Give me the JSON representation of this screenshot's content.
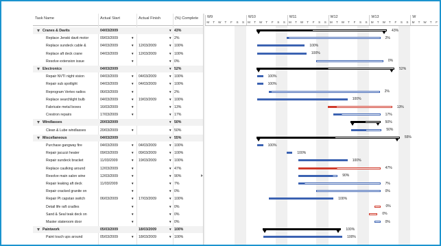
{
  "columns": {
    "name": "Task Name",
    "start": "Actual Start",
    "finish": "Actual Finish",
    "pct": "(%) Complete"
  },
  "dropdown_glyph": "▼",
  "colors": {
    "blue": "#3b62b2",
    "red": "#d03a2b",
    "summary": "#000000",
    "frame": "#1b93ce"
  },
  "weeks": [
    "W9",
    "W10",
    "W11",
    "W12",
    "W13",
    "W"
  ],
  "days": [
    "M",
    "T",
    "W",
    "T",
    "F",
    "S",
    "S"
  ],
  "rows": [
    {
      "level": 0,
      "name": "Cranes & Davits",
      "start": "04/03/2009",
      "finish": "",
      "pct": "43%",
      "bar": {
        "s": 8.8,
        "e": 31.0,
        "p": 0.43
      }
    },
    {
      "level": 1,
      "name": "Replace Jenski davit motor",
      "start": "09/03/2009",
      "finish": "",
      "pct": "2%",
      "bar": {
        "s": 13.9,
        "e": 29.9,
        "p": 0.02
      }
    },
    {
      "level": 1,
      "name": "Replace sundeck cable &",
      "start": "04/03/2009",
      "finish": "12/03/2009",
      "pct": "100%",
      "bar": {
        "s": 8.9,
        "e": 17.0,
        "p": 1.0
      }
    },
    {
      "level": 1,
      "name": "Replace aft deck crane",
      "start": "04/03/2009",
      "finish": "12/03/2009",
      "pct": "100%",
      "bar": {
        "s": 8.9,
        "e": 17.3,
        "p": 1.0
      }
    },
    {
      "level": 1,
      "name": "Resolve extension issue",
      "start": "",
      "finish": "",
      "pct": "0%",
      "bar": {
        "s": 18.9,
        "e": 30.4,
        "p": 0.0
      }
    },
    {
      "level": 0,
      "name": "Electronics",
      "start": "04/03/2009",
      "finish": "",
      "pct": "52%",
      "bar": {
        "s": 8.8,
        "e": 32.3,
        "p": 0.52
      }
    },
    {
      "level": 1,
      "name": "Repair NVTI night vision",
      "start": "04/03/2009",
      "finish": "04/03/2009",
      "pct": "100%",
      "bar": {
        "s": 8.9,
        "e": 9.9,
        "p": 1.0
      }
    },
    {
      "level": 1,
      "name": "Repair sub spotlight",
      "start": "04/03/2009",
      "finish": "04/03/2009",
      "pct": "100%",
      "bar": {
        "s": 8.9,
        "e": 9.9,
        "p": 1.0
      }
    },
    {
      "level": 1,
      "name": "Reprogram Vertex radios",
      "start": "06/03/2009",
      "finish": "",
      "pct": "2%",
      "bar": {
        "s": 10.9,
        "e": 29.8,
        "p": 0.02
      }
    },
    {
      "level": 1,
      "name": "Replace searchlight bulb",
      "start": "04/03/2009",
      "finish": "19/03/2009",
      "pct": "100%",
      "bar": {
        "s": 8.9,
        "e": 24.3,
        "p": 1.0
      }
    },
    {
      "level": 1,
      "name": "Fabricate metal boxes",
      "start": "16/03/2009",
      "finish": "",
      "pct": "13%",
      "bar": {
        "s": 20.9,
        "e": 31.9,
        "p": 0.13,
        "red": true
      }
    },
    {
      "level": 1,
      "name": "Crestron repairs",
      "start": "17/03/2009",
      "finish": "",
      "pct": "17%",
      "bar": {
        "s": 21.9,
        "e": 29.9,
        "p": 0.17
      }
    },
    {
      "level": 0,
      "name": "Windlasses",
      "start": "20/03/2009",
      "finish": "",
      "pct": "50%",
      "bar": {
        "s": 24.8,
        "e": 29.9,
        "p": 0.5
      }
    },
    {
      "level": 1,
      "name": "Clean & Lube windlasses",
      "start": "20/03/2009",
      "finish": "",
      "pct": "50%",
      "bar": {
        "s": 24.9,
        "e": 30.1,
        "p": 0.5
      }
    },
    {
      "level": 0,
      "name": "Miscellaneous",
      "start": "04/03/2009",
      "finish": "",
      "pct": "55%",
      "bar": {
        "s": 8.8,
        "e": 33.2,
        "p": 0.55
      }
    },
    {
      "level": 1,
      "name": "Purchase gangway fire",
      "start": "04/03/2009",
      "finish": "04/03/2009",
      "pct": "100%",
      "bar": {
        "s": 8.9,
        "e": 9.9,
        "p": 1.0
      }
    },
    {
      "level": 1,
      "name": "Repair jacuzzi heater",
      "start": "09/03/2009",
      "finish": "09/03/2009",
      "pct": "100%",
      "bar": {
        "s": 13.9,
        "e": 14.9,
        "p": 1.0
      }
    },
    {
      "level": 1,
      "name": "Repair sundeck bracket",
      "start": "11/03/2009",
      "finish": "19/03/2009",
      "pct": "100%",
      "bar": {
        "s": 15.9,
        "e": 24.3,
        "p": 1.0
      }
    },
    {
      "level": 1,
      "name": "Replace caulking around",
      "start": "12/03/2009",
      "finish": "",
      "pct": "47%",
      "bar": {
        "s": 15.9,
        "e": 29.9,
        "p": 0.47,
        "red": true
      }
    },
    {
      "level": 1,
      "name": "Resolve main salon wine",
      "start": "12/03/2009",
      "finish": "",
      "pct": "90%",
      "bar": {
        "s": 15.9,
        "e": 22.6,
        "p": 0.9
      }
    },
    {
      "level": 1,
      "name": "Repair leaking aft deck",
      "start": "11/03/2009",
      "finish": "",
      "pct": "7%",
      "bar": {
        "s": 15.9,
        "e": 29.9,
        "p": 0.07
      }
    },
    {
      "level": 1,
      "name": "Repair cracked granite on",
      "start": "",
      "finish": "",
      "pct": "0%",
      "bar": {
        "s": 18.9,
        "e": 29.9,
        "p": 0.0
      }
    },
    {
      "level": 1,
      "name": "Repair Pt capstan switch",
      "start": "06/03/2009",
      "finish": "17/03/2009",
      "pct": "100%",
      "bar": {
        "s": 10.9,
        "e": 21.9,
        "p": 1.0
      }
    },
    {
      "level": 1,
      "name": "Detail life raft cradles",
      "start": "",
      "finish": "",
      "pct": "0%",
      "bar": {
        "s": 28.9,
        "e": 30.0,
        "p": 0.0,
        "red": true
      }
    },
    {
      "level": 1,
      "name": "Sand & Seal teak deck on",
      "start": "",
      "finish": "",
      "pct": "0%",
      "bar": {
        "s": 27.9,
        "e": 29.4,
        "p": 0.0,
        "red": true
      }
    },
    {
      "level": 1,
      "name": "Master stateroom door",
      "start": "",
      "finish": "",
      "pct": "0%",
      "bar": {
        "s": 28.9,
        "e": 29.9,
        "p": 0.0
      }
    },
    {
      "level": 0,
      "name": "Paintwork",
      "start": "05/03/2009",
      "finish": "18/03/2009",
      "pct": "100%",
      "bar": {
        "s": 9.8,
        "e": 23.2,
        "p": 1.0
      }
    },
    {
      "level": 1,
      "name": "Paint touch ups around",
      "start": "05/03/2009",
      "finish": "18/03/2009",
      "pct": "100%",
      "bar": {
        "s": 9.9,
        "e": 23.4,
        "p": 1.0
      }
    }
  ]
}
